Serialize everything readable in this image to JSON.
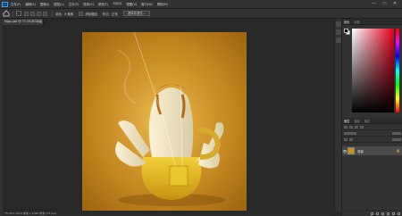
{
  "app": {
    "logo": "Ps",
    "colors": {
      "accent": "#31a8ff",
      "ui_bg": "#282828",
      "panel_bg": "#323232"
    }
  },
  "menubar": {
    "items": [
      "文件(F)",
      "编辑(E)",
      "图像(I)",
      "图层(L)",
      "文字(Y)",
      "选择(S)",
      "滤镜(T)",
      "3D(D)",
      "视图(V)",
      "窗口(W)",
      "帮助(H)"
    ],
    "window_controls": [
      "—",
      "▭",
      "✕"
    ]
  },
  "options_bar": {
    "feather_label": "羽化：",
    "feather_value": "0 像素",
    "antialias_label": "消除锯齿",
    "style_label": "样式：",
    "style_value": "正常",
    "select_mask_button": "选择并遮住..."
  },
  "document": {
    "tab_title": "Eggs.psd @ 75.3%(RGB/8)",
    "close_glyph": "×",
    "status": "75.32%  1024 像素 x 1080 像素 (72 ppi)"
  },
  "color_panel": {
    "tabs": [
      "颜色",
      "色板"
    ],
    "foreground": "#000000",
    "background": "#ffffff"
  },
  "layers_panel": {
    "tabs": [
      "图层",
      "通道",
      "路径"
    ],
    "layers": [
      {
        "name": "背景",
        "visible_glyph": "👁",
        "lock_glyph": "🔒"
      }
    ]
  }
}
